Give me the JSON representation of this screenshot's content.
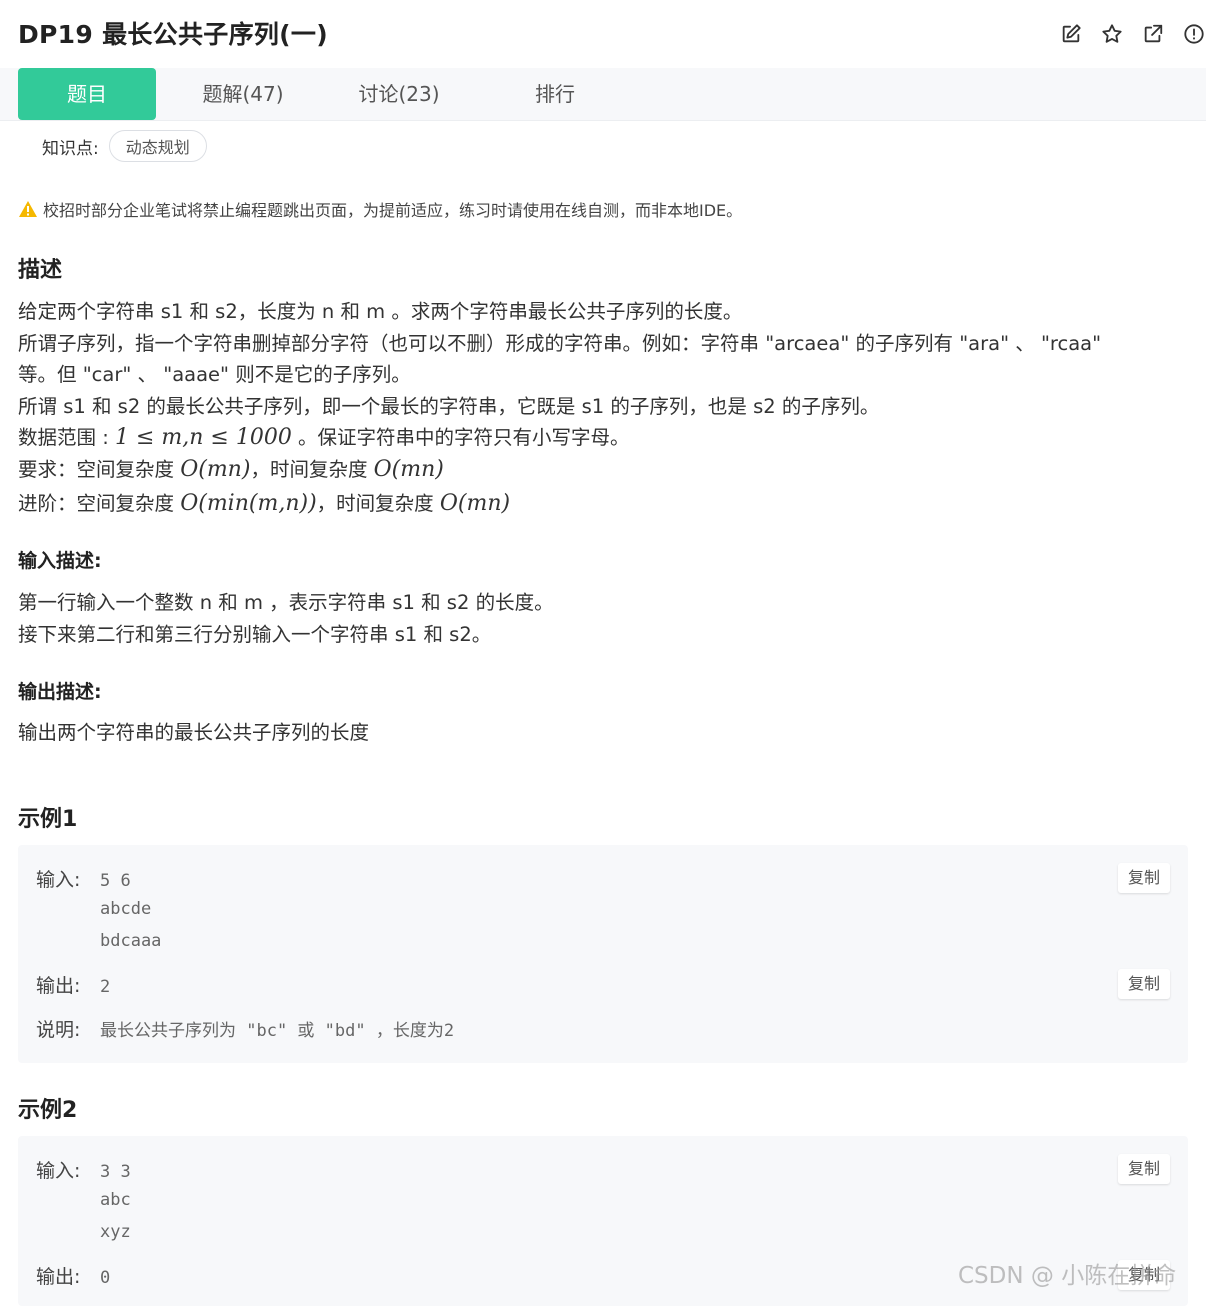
{
  "header": {
    "title": "DP19  最长公共子序列(一)"
  },
  "tabs": [
    {
      "label": "题目"
    },
    {
      "label": "题解(47)"
    },
    {
      "label": "讨论(23)"
    },
    {
      "label": "排行"
    }
  ],
  "knowledge": {
    "label": "知识点:",
    "tag": "动态规划"
  },
  "warning": "校招时部分企业笔试将禁止编程题跳出页面，为提前适应，练习时请使用在线自测，而非本地IDE。",
  "description": {
    "heading": "描述",
    "line1": "给定两个字符串 s1 和 s2，长度为 n 和 m  。求两个字符串最长公共子序列的长度。",
    "line2": "所谓子序列，指一个字符串删掉部分字符（也可以不删）形成的字符串。例如：字符串 \"arcaea\" 的子序列有 \"ara\" 、 \"rcaa\"",
    "line3": "等。但 \"car\" 、 \"aaae\" 则不是它的子序列。",
    "line4": "所谓 s1 和 s2 的最长公共子序列，即一个最长的字符串，它既是 s1 的子序列，也是 s2 的子序列。",
    "line5a": "数据范围 : ",
    "line5m": "1 ≤ m,n ≤ 1000",
    "line5b": " 。保证字符串中的字符只有小写字母。",
    "line6a": "要求：空间复杂度 ",
    "line6m1": "O(mn)",
    "line6b": "，时间复杂度 ",
    "line6m2": "O(mn)",
    "line7a": "进阶：空间复杂度 ",
    "line7m1": "O(min(m,n))",
    "line7b": "，时间复杂度 ",
    "line7m2": "O(mn)"
  },
  "input_desc": {
    "heading": "输入描述:",
    "line1": "第一行输入一个整数 n 和 m ，表示字符串 s1 和 s2 的长度。",
    "line2": "接下来第二行和第三行分别输入一个字符串 s1 和 s2。"
  },
  "output_desc": {
    "heading": "输出描述:",
    "line1": "输出两个字符串的最长公共子序列的长度"
  },
  "example1": {
    "heading": "示例1",
    "input_label": "输入:",
    "input_lines": [
      "5 6",
      "abcde",
      "bdcaaa"
    ],
    "output_label": "输出:",
    "output": "2",
    "explain_label": "说明:",
    "explain": "最长公共子序列为 \"bc\" 或 \"bd\" ，长度为2",
    "copy_label": "复制"
  },
  "example2": {
    "heading": "示例2",
    "input_label": "输入:",
    "input_lines": [
      "3 3",
      "abc",
      "xyz"
    ],
    "output_label": "输出:",
    "output": "0",
    "copy_label": "复制"
  },
  "watermark": "CSDN @  小陈在拼命",
  "colors": {
    "accent": "#32ca99",
    "warning": "#f5b800"
  },
  "icons": [
    "edit-icon",
    "star-icon",
    "share-icon",
    "report-icon",
    "warning-icon"
  ]
}
